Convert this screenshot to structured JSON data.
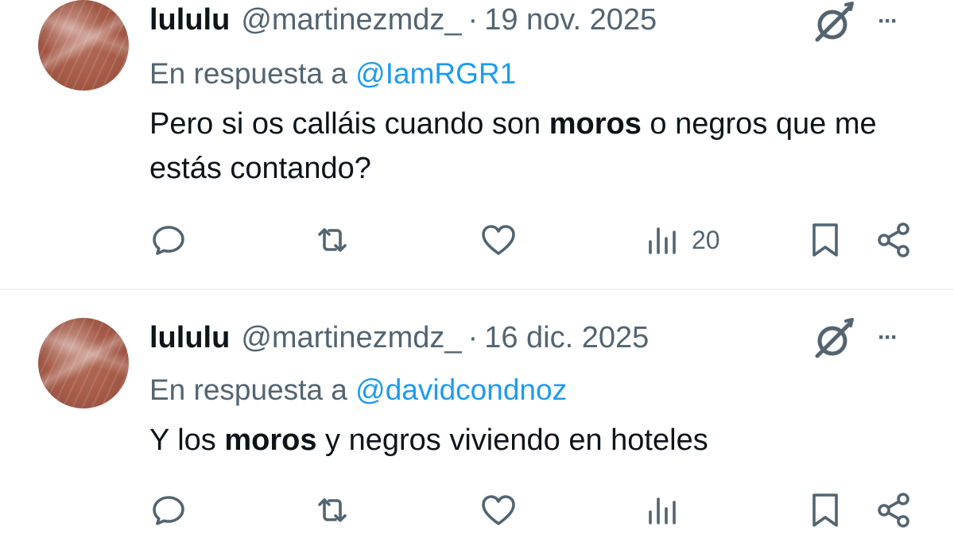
{
  "tweets": [
    {
      "name": "lululu",
      "handle": "@martinezmdz_",
      "separator": "·",
      "date": "19 nov. 2025",
      "reply_prefix": "En respuesta a ",
      "reply_to": "@IamRGR1",
      "text_parts": [
        "Pero si os calláis cuando son ",
        "moros",
        " o negros que me estás contando?"
      ],
      "more_label": "···",
      "views_count": "20"
    },
    {
      "name": "lululu",
      "handle": "@martinezmdz_",
      "separator": "·",
      "date": "16 dic. 2025",
      "reply_prefix": "En respuesta a ",
      "reply_to": "@davidcondnoz",
      "text_parts": [
        "Y los ",
        "moros",
        " y negros viviendo en hoteles"
      ],
      "more_label": "···",
      "views_count": ""
    }
  ],
  "icons": {
    "reply": "reply-icon",
    "retweet": "retweet-icon",
    "like": "heart-icon",
    "views": "views-icon",
    "bookmark": "bookmark-icon",
    "share": "share-icon",
    "grok": "grok-icon",
    "more": "more-icon"
  },
  "colors": {
    "text": "#0f1419",
    "secondary": "#536471",
    "link": "#1d9bf0",
    "divider": "#eff3f4"
  }
}
